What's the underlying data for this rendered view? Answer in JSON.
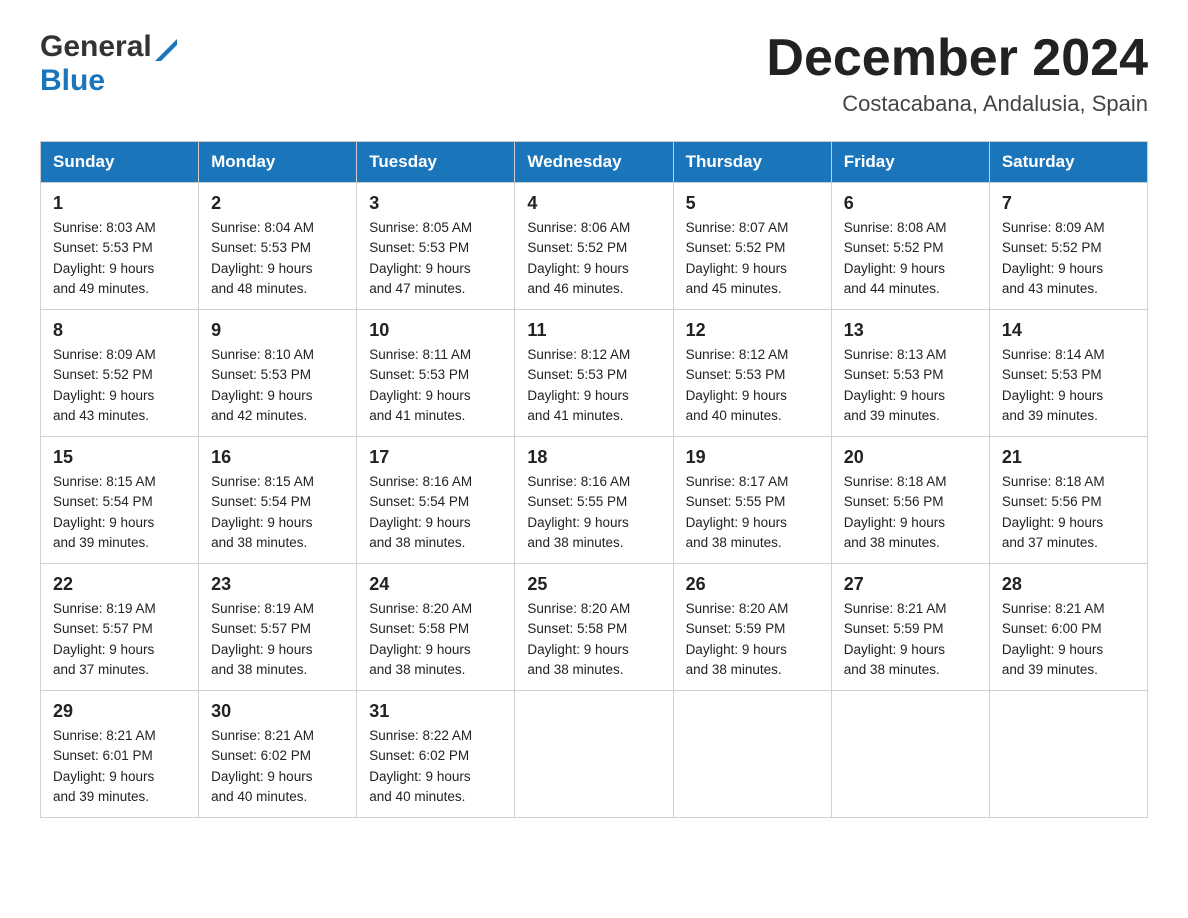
{
  "header": {
    "month_title": "December 2024",
    "location": "Costacabana, Andalusia, Spain",
    "logo_general": "General",
    "logo_blue": "Blue"
  },
  "columns": [
    "Sunday",
    "Monday",
    "Tuesday",
    "Wednesday",
    "Thursday",
    "Friday",
    "Saturday"
  ],
  "weeks": [
    [
      {
        "day": "1",
        "sunrise": "Sunrise: 8:03 AM",
        "sunset": "Sunset: 5:53 PM",
        "daylight": "Daylight: 9 hours",
        "daylight2": "and 49 minutes."
      },
      {
        "day": "2",
        "sunrise": "Sunrise: 8:04 AM",
        "sunset": "Sunset: 5:53 PM",
        "daylight": "Daylight: 9 hours",
        "daylight2": "and 48 minutes."
      },
      {
        "day": "3",
        "sunrise": "Sunrise: 8:05 AM",
        "sunset": "Sunset: 5:53 PM",
        "daylight": "Daylight: 9 hours",
        "daylight2": "and 47 minutes."
      },
      {
        "day": "4",
        "sunrise": "Sunrise: 8:06 AM",
        "sunset": "Sunset: 5:52 PM",
        "daylight": "Daylight: 9 hours",
        "daylight2": "and 46 minutes."
      },
      {
        "day": "5",
        "sunrise": "Sunrise: 8:07 AM",
        "sunset": "Sunset: 5:52 PM",
        "daylight": "Daylight: 9 hours",
        "daylight2": "and 45 minutes."
      },
      {
        "day": "6",
        "sunrise": "Sunrise: 8:08 AM",
        "sunset": "Sunset: 5:52 PM",
        "daylight": "Daylight: 9 hours",
        "daylight2": "and 44 minutes."
      },
      {
        "day": "7",
        "sunrise": "Sunrise: 8:09 AM",
        "sunset": "Sunset: 5:52 PM",
        "daylight": "Daylight: 9 hours",
        "daylight2": "and 43 minutes."
      }
    ],
    [
      {
        "day": "8",
        "sunrise": "Sunrise: 8:09 AM",
        "sunset": "Sunset: 5:52 PM",
        "daylight": "Daylight: 9 hours",
        "daylight2": "and 43 minutes."
      },
      {
        "day": "9",
        "sunrise": "Sunrise: 8:10 AM",
        "sunset": "Sunset: 5:53 PM",
        "daylight": "Daylight: 9 hours",
        "daylight2": "and 42 minutes."
      },
      {
        "day": "10",
        "sunrise": "Sunrise: 8:11 AM",
        "sunset": "Sunset: 5:53 PM",
        "daylight": "Daylight: 9 hours",
        "daylight2": "and 41 minutes."
      },
      {
        "day": "11",
        "sunrise": "Sunrise: 8:12 AM",
        "sunset": "Sunset: 5:53 PM",
        "daylight": "Daylight: 9 hours",
        "daylight2": "and 41 minutes."
      },
      {
        "day": "12",
        "sunrise": "Sunrise: 8:12 AM",
        "sunset": "Sunset: 5:53 PM",
        "daylight": "Daylight: 9 hours",
        "daylight2": "and 40 minutes."
      },
      {
        "day": "13",
        "sunrise": "Sunrise: 8:13 AM",
        "sunset": "Sunset: 5:53 PM",
        "daylight": "Daylight: 9 hours",
        "daylight2": "and 39 minutes."
      },
      {
        "day": "14",
        "sunrise": "Sunrise: 8:14 AM",
        "sunset": "Sunset: 5:53 PM",
        "daylight": "Daylight: 9 hours",
        "daylight2": "and 39 minutes."
      }
    ],
    [
      {
        "day": "15",
        "sunrise": "Sunrise: 8:15 AM",
        "sunset": "Sunset: 5:54 PM",
        "daylight": "Daylight: 9 hours",
        "daylight2": "and 39 minutes."
      },
      {
        "day": "16",
        "sunrise": "Sunrise: 8:15 AM",
        "sunset": "Sunset: 5:54 PM",
        "daylight": "Daylight: 9 hours",
        "daylight2": "and 38 minutes."
      },
      {
        "day": "17",
        "sunrise": "Sunrise: 8:16 AM",
        "sunset": "Sunset: 5:54 PM",
        "daylight": "Daylight: 9 hours",
        "daylight2": "and 38 minutes."
      },
      {
        "day": "18",
        "sunrise": "Sunrise: 8:16 AM",
        "sunset": "Sunset: 5:55 PM",
        "daylight": "Daylight: 9 hours",
        "daylight2": "and 38 minutes."
      },
      {
        "day": "19",
        "sunrise": "Sunrise: 8:17 AM",
        "sunset": "Sunset: 5:55 PM",
        "daylight": "Daylight: 9 hours",
        "daylight2": "and 38 minutes."
      },
      {
        "day": "20",
        "sunrise": "Sunrise: 8:18 AM",
        "sunset": "Sunset: 5:56 PM",
        "daylight": "Daylight: 9 hours",
        "daylight2": "and 38 minutes."
      },
      {
        "day": "21",
        "sunrise": "Sunrise: 8:18 AM",
        "sunset": "Sunset: 5:56 PM",
        "daylight": "Daylight: 9 hours",
        "daylight2": "and 37 minutes."
      }
    ],
    [
      {
        "day": "22",
        "sunrise": "Sunrise: 8:19 AM",
        "sunset": "Sunset: 5:57 PM",
        "daylight": "Daylight: 9 hours",
        "daylight2": "and 37 minutes."
      },
      {
        "day": "23",
        "sunrise": "Sunrise: 8:19 AM",
        "sunset": "Sunset: 5:57 PM",
        "daylight": "Daylight: 9 hours",
        "daylight2": "and 38 minutes."
      },
      {
        "day": "24",
        "sunrise": "Sunrise: 8:20 AM",
        "sunset": "Sunset: 5:58 PM",
        "daylight": "Daylight: 9 hours",
        "daylight2": "and 38 minutes."
      },
      {
        "day": "25",
        "sunrise": "Sunrise: 8:20 AM",
        "sunset": "Sunset: 5:58 PM",
        "daylight": "Daylight: 9 hours",
        "daylight2": "and 38 minutes."
      },
      {
        "day": "26",
        "sunrise": "Sunrise: 8:20 AM",
        "sunset": "Sunset: 5:59 PM",
        "daylight": "Daylight: 9 hours",
        "daylight2": "and 38 minutes."
      },
      {
        "day": "27",
        "sunrise": "Sunrise: 8:21 AM",
        "sunset": "Sunset: 5:59 PM",
        "daylight": "Daylight: 9 hours",
        "daylight2": "and 38 minutes."
      },
      {
        "day": "28",
        "sunrise": "Sunrise: 8:21 AM",
        "sunset": "Sunset: 6:00 PM",
        "daylight": "Daylight: 9 hours",
        "daylight2": "and 39 minutes."
      }
    ],
    [
      {
        "day": "29",
        "sunrise": "Sunrise: 8:21 AM",
        "sunset": "Sunset: 6:01 PM",
        "daylight": "Daylight: 9 hours",
        "daylight2": "and 39 minutes."
      },
      {
        "day": "30",
        "sunrise": "Sunrise: 8:21 AM",
        "sunset": "Sunset: 6:02 PM",
        "daylight": "Daylight: 9 hours",
        "daylight2": "and 40 minutes."
      },
      {
        "day": "31",
        "sunrise": "Sunrise: 8:22 AM",
        "sunset": "Sunset: 6:02 PM",
        "daylight": "Daylight: 9 hours",
        "daylight2": "and 40 minutes."
      },
      {
        "day": "",
        "sunrise": "",
        "sunset": "",
        "daylight": "",
        "daylight2": ""
      },
      {
        "day": "",
        "sunrise": "",
        "sunset": "",
        "daylight": "",
        "daylight2": ""
      },
      {
        "day": "",
        "sunrise": "",
        "sunset": "",
        "daylight": "",
        "daylight2": ""
      },
      {
        "day": "",
        "sunrise": "",
        "sunset": "",
        "daylight": "",
        "daylight2": ""
      }
    ]
  ]
}
